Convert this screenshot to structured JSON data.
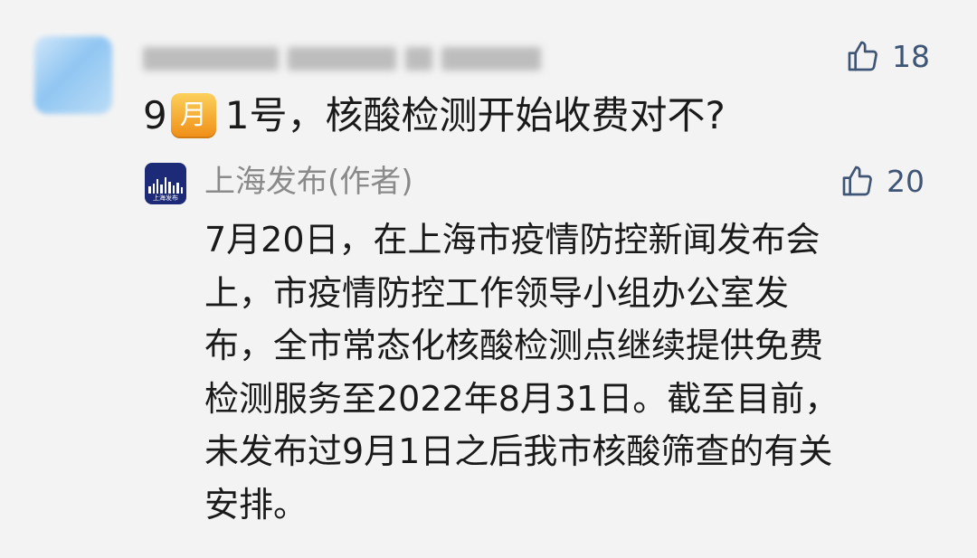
{
  "comment": {
    "month_badge": "月",
    "text_before": "9",
    "text_after": " 1号，核酸检测开始收费对不?",
    "likes": "18"
  },
  "reply": {
    "author": "上海发布(作者)",
    "logo_caption": "上海发布",
    "likes": "20",
    "lines": [
      "7月20日，在上海市疫情防控新闻发布会",
      "上，市疫情防控工作领导小组办公室发",
      "布，全市常态化核酸检测点继续提供免费",
      "检测服务至2022年8月31日。截至目前，",
      "未发布过9月1日之后我市核酸筛查的有关",
      "安排。"
    ]
  },
  "colors": {
    "background": "#f3f3f3",
    "like_icon": "#3f5575",
    "author_gray": "#8a8a8a",
    "badge_orange": "#f08d15",
    "logo_navy": "#1d2a78"
  },
  "icons": [
    "thumbs-up-icon",
    "month-emoji-icon",
    "shanghai-logo-icon"
  ]
}
